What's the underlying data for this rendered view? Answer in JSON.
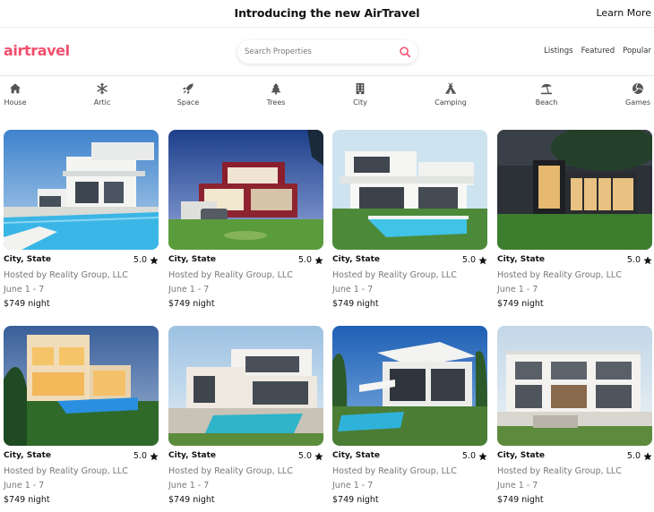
{
  "announcement": {
    "title": "Introducing the new AirTravel",
    "link": "Learn More"
  },
  "header": {
    "logo": "airtravel",
    "search_placeholder": "Search Properties",
    "nav": [
      "Listings",
      "Featured",
      "Popular"
    ]
  },
  "colors": {
    "brand": "#f0506e"
  },
  "categories": [
    {
      "label": "House",
      "icon": "house-icon"
    },
    {
      "label": "Artic",
      "icon": "snowflake-icon"
    },
    {
      "label": "Space",
      "icon": "rocket-icon"
    },
    {
      "label": "Trees",
      "icon": "tree-icon"
    },
    {
      "label": "City",
      "icon": "building-icon"
    },
    {
      "label": "Camping",
      "icon": "tent-icon"
    },
    {
      "label": "Beach",
      "icon": "umbrella-beach-icon"
    },
    {
      "label": "Games",
      "icon": "volleyball-icon"
    }
  ],
  "listings": [
    {
      "city": "City, State",
      "rating": "5.0",
      "host": "Hosted by Reality Group, LLC",
      "dates": "June 1 - 7",
      "price": "$749 night"
    },
    {
      "city": "City, State",
      "rating": "5.0",
      "host": "Hosted by Reality Group, LLC",
      "dates": "June 1 - 7",
      "price": "$749 night"
    },
    {
      "city": "City, State",
      "rating": "5.0",
      "host": "Hosted by Reality Group, LLC",
      "dates": "June 1 - 7",
      "price": "$749 night"
    },
    {
      "city": "City, State",
      "rating": "5.0",
      "host": "Hosted by Reality Group, LLC",
      "dates": "June 1 - 7",
      "price": "$749 night"
    },
    {
      "city": "City, State",
      "rating": "5.0",
      "host": "Hosted by Reality Group, LLC",
      "dates": "June 1 - 7",
      "price": "$749 night"
    },
    {
      "city": "City, State",
      "rating": "5.0",
      "host": "Hosted by Reality Group, LLC",
      "dates": "June 1 - 7",
      "price": "$749 night"
    },
    {
      "city": "City, State",
      "rating": "5.0",
      "host": "Hosted by Reality Group, LLC",
      "dates": "June 1 - 7",
      "price": "$749 night"
    },
    {
      "city": "City, State",
      "rating": "5.0",
      "host": "Hosted by Reality Group, LLC",
      "dates": "June 1 - 7",
      "price": "$749 night"
    }
  ]
}
